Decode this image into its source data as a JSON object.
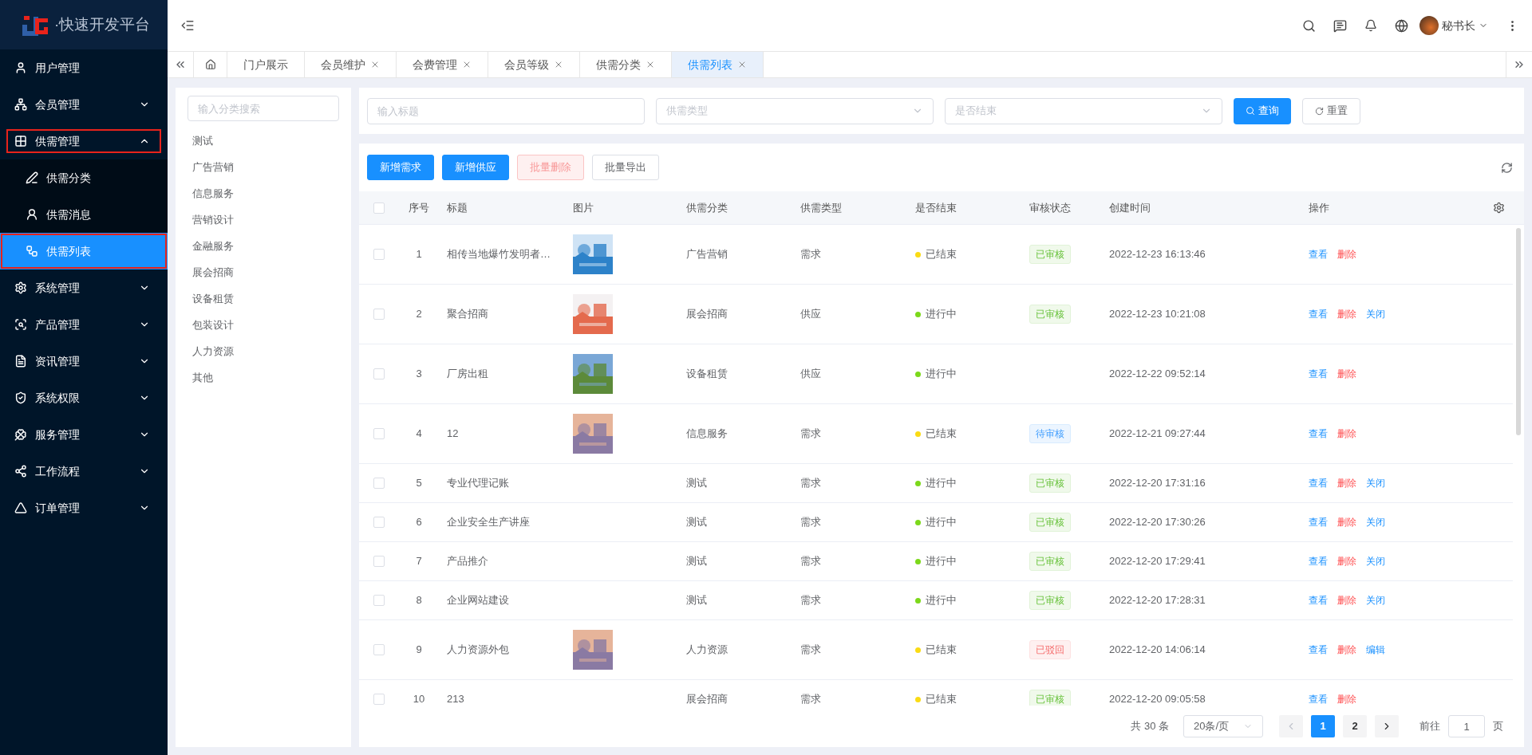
{
  "sidebar": {
    "logo_text": "·快速开发平台",
    "items": [
      {
        "label": "用户管理",
        "selected": false,
        "annotated": false
      },
      {
        "label": "会员管理",
        "expanded": false,
        "selected": false,
        "annotated": false
      },
      {
        "label": "供需管理",
        "expanded": true,
        "selected": false,
        "annotated": true,
        "children": [
          {
            "label": "供需分类",
            "selected": false,
            "annotated": false
          },
          {
            "label": "供需消息",
            "selected": false,
            "annotated": false
          },
          {
            "label": "供需列表",
            "selected": true,
            "annotated": true
          }
        ]
      },
      {
        "label": "系统管理",
        "expanded": false,
        "selected": false,
        "annotated": false
      },
      {
        "label": "产品管理",
        "expanded": false,
        "selected": false,
        "annotated": false
      },
      {
        "label": "资讯管理",
        "expanded": false,
        "selected": false,
        "annotated": false
      },
      {
        "label": "系统权限",
        "expanded": false,
        "selected": false,
        "annotated": false
      },
      {
        "label": "服务管理",
        "expanded": false,
        "selected": false,
        "annotated": false
      },
      {
        "label": "工作流程",
        "expanded": false,
        "selected": false,
        "annotated": false
      },
      {
        "label": "订单管理",
        "expanded": false,
        "selected": false,
        "annotated": false
      }
    ]
  },
  "header": {
    "user_name": "秘书长"
  },
  "tabs": [
    {
      "kind": "home",
      "selected": false
    },
    {
      "kind": "page",
      "label": "门户展示",
      "closable": false,
      "selected": false
    },
    {
      "kind": "page",
      "label": "会员维护",
      "closable": true,
      "selected": false
    },
    {
      "kind": "page",
      "label": "会费管理",
      "closable": true,
      "selected": false
    },
    {
      "kind": "page",
      "label": "会员等级",
      "closable": true,
      "selected": false
    },
    {
      "kind": "page",
      "label": "供需分类",
      "closable": true,
      "selected": false
    },
    {
      "kind": "page",
      "label": "供需列表",
      "closable": true,
      "selected": true
    }
  ],
  "categories": {
    "search_placeholder": "输入分类搜索",
    "items": [
      "测试",
      "广告营销",
      "信息服务",
      "营销设计",
      "金融服务",
      "展会招商",
      "设备租赁",
      "包装设计",
      "人力资源",
      "其他"
    ]
  },
  "filters": {
    "title_placeholder": "输入标题",
    "type_placeholder": "供需类型",
    "ended_placeholder": "是否结束",
    "search_button": "查询",
    "reset_button": "重置"
  },
  "toolbar": [
    {
      "label": "新增需求",
      "kind": "primary"
    },
    {
      "label": "新增供应",
      "kind": "primary"
    },
    {
      "label": "批量删除",
      "kind": "danger"
    },
    {
      "label": "批量导出",
      "kind": "default"
    }
  ],
  "table": {
    "all_checked": false,
    "columns": [
      "序号",
      "标题",
      "图片",
      "供需分类",
      "供需类型",
      "是否结束",
      "审核状态",
      "创建时间",
      "操作"
    ],
    "rows": [
      {
        "index": "1",
        "title": "相传当地爆竹发明者…",
        "has_picture": true,
        "category": "广告营销",
        "type": "需求",
        "status": {
          "label": "已结束",
          "color": "#fadb14"
        },
        "review": {
          "label": "已审核",
          "kind": "approved"
        },
        "created": "2022-12-23 16:13:46",
        "actions": [
          {
            "label": "查看",
            "kind": "view"
          },
          {
            "label": "删除",
            "kind": "delete"
          }
        ],
        "checked": false
      },
      {
        "index": "2",
        "title": "聚合招商",
        "has_picture": true,
        "category": "展会招商",
        "type": "供应",
        "status": {
          "label": "进行中",
          "color": "#7cd81a"
        },
        "review": {
          "label": "已审核",
          "kind": "approved"
        },
        "created": "2022-12-23 10:21:08",
        "actions": [
          {
            "label": "查看",
            "kind": "view"
          },
          {
            "label": "删除",
            "kind": "delete"
          },
          {
            "label": "关闭",
            "kind": "view"
          }
        ],
        "checked": false
      },
      {
        "index": "3",
        "title": "厂房出租",
        "has_picture": true,
        "category": "设备租赁",
        "type": "供应",
        "status": {
          "label": "进行中",
          "color": "#7cd81a"
        },
        "created": "2022-12-22 09:52:14",
        "actions": [
          {
            "label": "查看",
            "kind": "view"
          },
          {
            "label": "删除",
            "kind": "delete"
          }
        ],
        "checked": false
      },
      {
        "index": "4",
        "title": "12",
        "has_picture": true,
        "category": "信息服务",
        "type": "需求",
        "status": {
          "label": "已结束",
          "color": "#fadb14"
        },
        "review": {
          "label": "待审核",
          "kind": "pending"
        },
        "created": "2022-12-21 09:27:44",
        "actions": [
          {
            "label": "查看",
            "kind": "view"
          },
          {
            "label": "删除",
            "kind": "delete"
          }
        ],
        "checked": false
      },
      {
        "index": "5",
        "title": "专业代理记账",
        "has_picture": false,
        "category": "测试",
        "type": "需求",
        "status": {
          "label": "进行中",
          "color": "#7cd81a"
        },
        "review": {
          "label": "已审核",
          "kind": "approved"
        },
        "created": "2022-12-20 17:31:16",
        "actions": [
          {
            "label": "查看",
            "kind": "view"
          },
          {
            "label": "删除",
            "kind": "delete"
          },
          {
            "label": "关闭",
            "kind": "view"
          }
        ],
        "checked": false
      },
      {
        "index": "6",
        "title": "企业安全生产讲座",
        "has_picture": false,
        "category": "测试",
        "type": "需求",
        "status": {
          "label": "进行中",
          "color": "#7cd81a"
        },
        "review": {
          "label": "已审核",
          "kind": "approved"
        },
        "created": "2022-12-20 17:30:26",
        "actions": [
          {
            "label": "查看",
            "kind": "view"
          },
          {
            "label": "删除",
            "kind": "delete"
          },
          {
            "label": "关闭",
            "kind": "view"
          }
        ],
        "checked": false
      },
      {
        "index": "7",
        "title": "产品推介",
        "has_picture": false,
        "category": "测试",
        "type": "需求",
        "status": {
          "label": "进行中",
          "color": "#7cd81a"
        },
        "review": {
          "label": "已审核",
          "kind": "approved"
        },
        "created": "2022-12-20 17:29:41",
        "actions": [
          {
            "label": "查看",
            "kind": "view"
          },
          {
            "label": "删除",
            "kind": "delete"
          },
          {
            "label": "关闭",
            "kind": "view"
          }
        ],
        "checked": false
      },
      {
        "index": "8",
        "title": "企业网站建设",
        "has_picture": false,
        "category": "测试",
        "type": "需求",
        "status": {
          "label": "进行中",
          "color": "#7cd81a"
        },
        "review": {
          "label": "已审核",
          "kind": "approved"
        },
        "created": "2022-12-20 17:28:31",
        "actions": [
          {
            "label": "查看",
            "kind": "view"
          },
          {
            "label": "删除",
            "kind": "delete"
          },
          {
            "label": "关闭",
            "kind": "view"
          }
        ],
        "checked": false
      },
      {
        "index": "9",
        "title": "人力资源外包",
        "has_picture": true,
        "category": "人力资源",
        "type": "需求",
        "status": {
          "label": "已结束",
          "color": "#fadb14"
        },
        "review": {
          "label": "已驳回",
          "kind": "rejected"
        },
        "created": "2022-12-20 14:06:14",
        "actions": [
          {
            "label": "查看",
            "kind": "view"
          },
          {
            "label": "删除",
            "kind": "delete"
          },
          {
            "label": "编辑",
            "kind": "view"
          }
        ],
        "checked": false
      },
      {
        "index": "10",
        "title": "213",
        "has_picture": false,
        "category": "展会招商",
        "type": "需求",
        "status": {
          "label": "已结束",
          "color": "#fadb14"
        },
        "review": {
          "label": "已审核",
          "kind": "approved"
        },
        "created": "2022-12-20 09:05:58",
        "actions": [
          {
            "label": "查看",
            "kind": "view"
          },
          {
            "label": "删除",
            "kind": "delete"
          }
        ],
        "checked": false
      }
    ]
  },
  "pagination": {
    "total": "共 30 条",
    "page_size": "20条/页",
    "pages": [
      {
        "label": "1",
        "selected": true
      },
      {
        "label": "2",
        "selected": false
      }
    ],
    "prev_disabled": true,
    "goto_label": "前往",
    "goto_value": "1",
    "page_suffix": "页"
  }
}
